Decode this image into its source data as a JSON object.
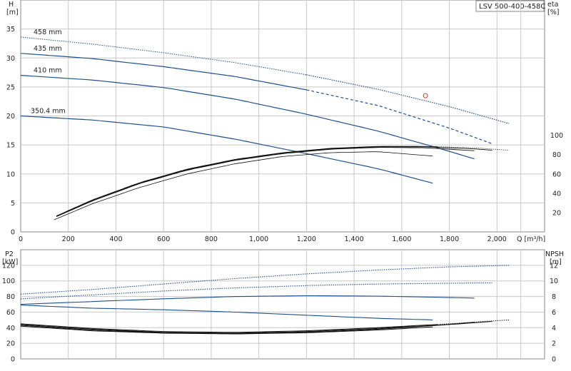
{
  "title": "LSV 500-400-458C",
  "chart_data": [
    {
      "type": "line",
      "name": "performance",
      "xlabel": "Q [m³/h]",
      "ylabel_left": [
        "H",
        "[m]"
      ],
      "ylabel_right": [
        "eta",
        "[%]"
      ],
      "xlim": [
        0,
        2200
      ],
      "ylim_left": [
        0,
        40
      ],
      "ylim_right": [
        0,
        240
      ],
      "x_ticks": [
        0,
        200,
        400,
        600,
        800,
        1000,
        1200,
        1400,
        1600,
        1800,
        2000
      ],
      "x_tick_labels": [
        "0",
        "200",
        "400",
        "600",
        "800",
        "1,000",
        "1,200",
        "1,400",
        "1,600",
        "1,800",
        "2,000"
      ],
      "y_ticks_left": [
        0,
        5,
        10,
        15,
        20,
        25,
        30,
        35
      ],
      "y_ticks_right": [
        20,
        40,
        60,
        80,
        100
      ],
      "grid": true,
      "head_curves": [
        {
          "label": "458 mm",
          "x": [
            0,
            300,
            600,
            900,
            1200,
            1500,
            1800,
            2050
          ],
          "y": [
            33.6,
            32.4,
            30.9,
            29.2,
            27.1,
            24.6,
            21.6,
            18.7
          ],
          "dashed_from": 1200,
          "dashed_to": 1500,
          "dotted_after": 1500
        },
        {
          "label": "435 mm",
          "x": [
            0,
            300,
            600,
            900,
            1200,
            1500,
            1800,
            1980
          ],
          "y": [
            30.8,
            29.9,
            28.5,
            26.8,
            24.5,
            21.8,
            17.9,
            15.2
          ],
          "dashed_from": 1200,
          "dashed_to": 1500
        },
        {
          "label": "410 mm",
          "x": [
            0,
            300,
            600,
            900,
            1200,
            1500,
            1750,
            1905
          ],
          "y": [
            27.0,
            26.2,
            24.9,
            22.9,
            20.3,
            17.4,
            14.5,
            12.6
          ]
        },
        {
          "label": "350.4 mm",
          "x": [
            0,
            300,
            600,
            900,
            1200,
            1500,
            1730
          ],
          "y": [
            20.0,
            19.3,
            18.1,
            16.0,
            13.5,
            10.9,
            8.4
          ]
        }
      ],
      "efficiency_curves": [
        {
          "x": [
            150,
            300,
            500,
            700,
            900,
            1100,
            1300,
            1500,
            1700,
            1900,
            2050
          ],
          "y": [
            16.5,
            33,
            51,
            65,
            75,
            82,
            86.5,
            88.5,
            88.5,
            87,
            84.5
          ],
          "style": "dotted-end"
        },
        {
          "x": [
            150,
            300,
            500,
            700,
            900,
            1100,
            1300,
            1500,
            1700,
            1900,
            1980
          ],
          "y": [
            16.2,
            32.5,
            50.5,
            64.5,
            74.5,
            81.5,
            86,
            88,
            88,
            86,
            84.5
          ]
        },
        {
          "x": [
            150,
            300,
            500,
            700,
            900,
            1100,
            1300,
            1500,
            1700,
            1905
          ],
          "y": [
            15.8,
            32,
            50,
            64,
            74,
            81,
            85.5,
            87.5,
            87,
            84
          ]
        },
        {
          "x": [
            140,
            300,
            500,
            700,
            900,
            1100,
            1300,
            1500,
            1730
          ],
          "y": [
            12.5,
            29,
            46,
            60,
            70.5,
            78,
            82,
            83,
            78.5
          ]
        }
      ],
      "duty_point": {
        "x": 1700,
        "y": 23.5
      }
    },
    {
      "type": "line",
      "name": "power_npsh",
      "xlabel": "",
      "ylabel_left": [
        "P2",
        "[kW]"
      ],
      "ylabel_right": [
        "NPSH",
        "[m]"
      ],
      "xlim": [
        0,
        2200
      ],
      "ylim_left": [
        0,
        140
      ],
      "ylim_right": [
        0,
        14
      ],
      "y_ticks_left": [
        0,
        20,
        40,
        60,
        80,
        100,
        120
      ],
      "y_ticks_right": [
        0,
        2,
        4,
        6,
        8,
        10,
        12
      ],
      "grid": true,
      "power_curves": [
        {
          "x": [
            0,
            300,
            600,
            900,
            1200,
            1500,
            1800,
            2050
          ],
          "y": [
            83,
            89,
            96,
            103,
            109,
            114,
            118,
            120
          ],
          "style": "dotted"
        },
        {
          "x": [
            0,
            300,
            600,
            900,
            1200,
            1500,
            1800,
            1980
          ],
          "y": [
            77,
            82,
            87,
            91,
            94,
            96,
            97,
            97.5
          ],
          "style": "dotted"
        },
        {
          "x": [
            0,
            300,
            600,
            900,
            1200,
            1500,
            1750,
            1905
          ],
          "y": [
            70,
            73.5,
            77,
            80,
            81,
            80.5,
            79,
            78
          ]
        },
        {
          "x": [
            0,
            300,
            600,
            900,
            1200,
            1500,
            1730
          ],
          "y": [
            69,
            65,
            63,
            60,
            56,
            52,
            50
          ]
        }
      ],
      "npsh_curves": [
        {
          "x": [
            0,
            300,
            600,
            900,
            1200,
            1500,
            1800,
            2050
          ],
          "y": [
            4.5,
            3.9,
            3.5,
            3.4,
            3.6,
            4.0,
            4.5,
            5.0
          ]
        },
        {
          "x": [
            0,
            300,
            600,
            900,
            1200,
            1500,
            1800,
            1980
          ],
          "y": [
            4.4,
            3.8,
            3.4,
            3.3,
            3.5,
            3.9,
            4.4,
            4.8
          ]
        },
        {
          "x": [
            0,
            300,
            600,
            900,
            1200,
            1500,
            1750,
            1905
          ],
          "y": [
            4.3,
            3.7,
            3.35,
            3.25,
            3.4,
            3.8,
            4.3,
            4.7
          ]
        },
        {
          "x": [
            0,
            300,
            600,
            900,
            1200,
            1500,
            1730
          ],
          "y": [
            4.2,
            3.6,
            3.3,
            3.2,
            3.35,
            3.7,
            4.1
          ]
        }
      ]
    }
  ]
}
